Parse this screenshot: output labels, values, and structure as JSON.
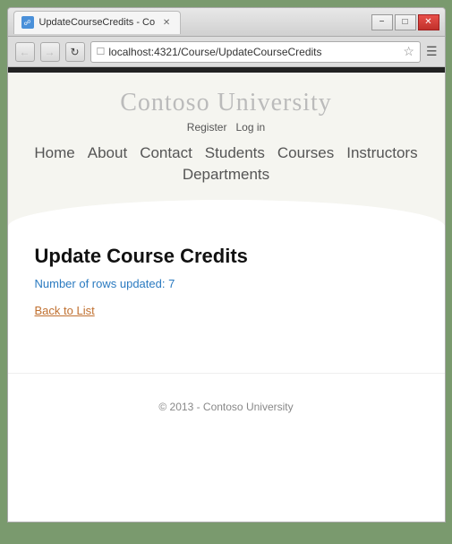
{
  "browser": {
    "tab_title": "UpdateCourseCredits - Co",
    "url": "localhost:4321/Course/UpdateCourseCredits",
    "window_controls": {
      "minimize": "−",
      "maximize": "□",
      "close": "✕"
    }
  },
  "site": {
    "title": "Contoso University",
    "auth": {
      "register": "Register",
      "login": "Log in"
    },
    "nav": [
      "Home",
      "About",
      "Contact",
      "Students",
      "Courses",
      "Instructors",
      "Departments"
    ]
  },
  "page": {
    "heading": "Update Course Credits",
    "rows_updated_label": "Number of rows updated: 7",
    "back_link": "Back to List"
  },
  "footer": {
    "text": "© 2013 - Contoso University"
  }
}
